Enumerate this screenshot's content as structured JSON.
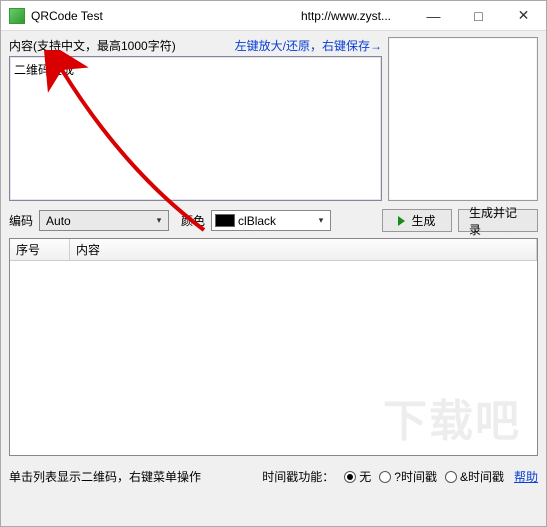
{
  "titlebar": {
    "title": "QRCode Test",
    "url": "http://www.zyst..."
  },
  "content": {
    "label": "内容(支持中文，最高1000字符)",
    "hint": "左键放大/还原，右键保存→",
    "value": "二维码生成"
  },
  "encoding": {
    "label": "编码",
    "value": "Auto"
  },
  "color": {
    "label": "颜色",
    "value": "clBlack",
    "swatch": "#000000"
  },
  "buttons": {
    "generate": "生成",
    "generate_record": "生成并记录"
  },
  "table": {
    "headers": {
      "seq": "序号",
      "content": "内容"
    },
    "rows": []
  },
  "bottom": {
    "tip": "单击列表显示二维码，右键菜单操作",
    "ts_label": "时间戳功能：",
    "opts": {
      "none": "无",
      "q": "?时间戳",
      "amp": "&时间戳"
    },
    "selected": "none",
    "help": "帮助"
  },
  "watermark": "下载吧"
}
